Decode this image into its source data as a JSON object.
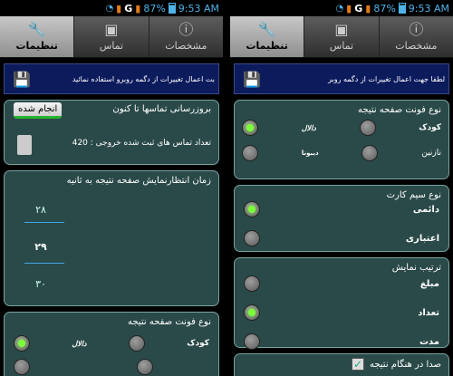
{
  "status": {
    "time": "9:53 AM",
    "battery": "87%",
    "network": "G"
  },
  "tabs": [
    {
      "label": "مشخصات",
      "icon": "info-icon"
    },
    {
      "label": "تماس",
      "icon": "contacts-icon"
    },
    {
      "label": "تنظیمات",
      "icon": "wrench-icon"
    }
  ],
  "left": {
    "notice": "بت اعمال تغییرات از دگمه روبرو استفاده نمائید",
    "sync": {
      "title": "بروزرسانی تماسها تا کنون",
      "button": "انجام شده",
      "count_text": "تعداد تماس های ثبت شده خروجی : 420"
    },
    "wait": {
      "title": "زمان انتظارنمایش صفحه نتیجه به ثانیه",
      "values": [
        "۲۸",
        "۲۹",
        "۳۰"
      ]
    },
    "font": {
      "title": "نوع فونت صفحه نتیجه",
      "options": [
        "کودک",
        "دالال"
      ]
    }
  },
  "right": {
    "notice": "لطفا جهت اعمال تغییرات از دگمه روبر",
    "font": {
      "title": "نوع فونت صفحه نتیجه",
      "options": [
        "کودک",
        "دالال",
        "نازنین",
        "ديبونا"
      ]
    },
    "sim": {
      "title": "نوع سیم کارت",
      "options": [
        "دائمی",
        "اعتباری"
      ]
    },
    "order": {
      "title": "ترتیب نمایش",
      "options": [
        "مبلغ",
        "تعداد",
        "مدت"
      ]
    },
    "bottom_text": "صدا در هنگام نتیجه"
  }
}
